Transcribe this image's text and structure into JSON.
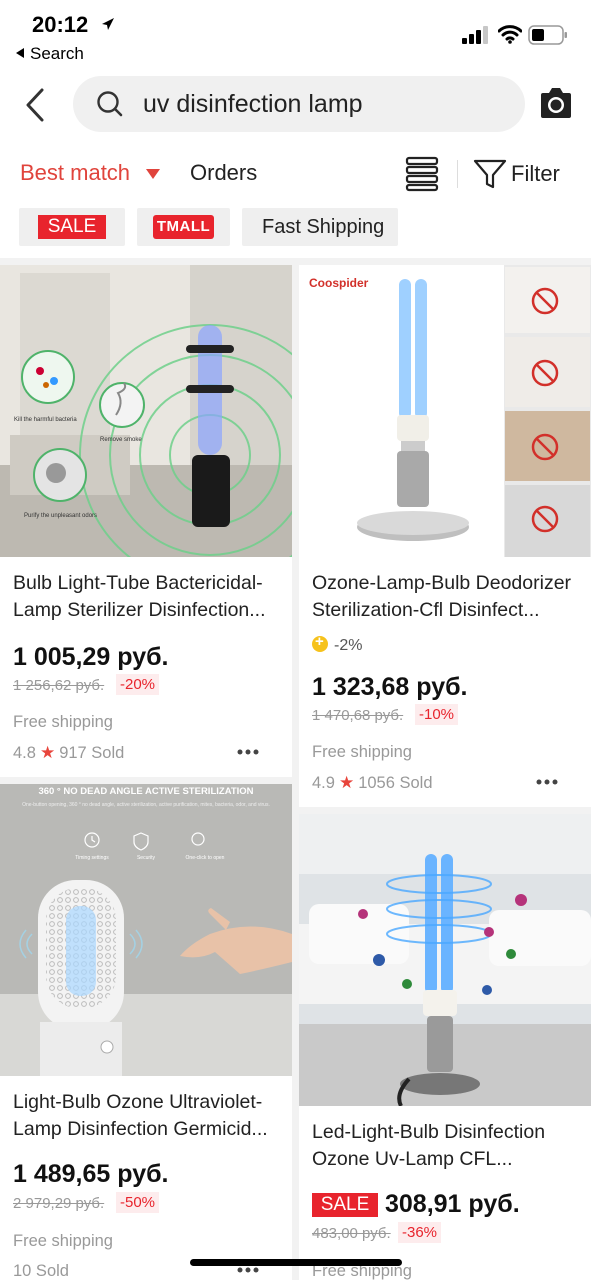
{
  "status": {
    "time": "20:12",
    "back_app": "Search"
  },
  "search": {
    "query": "uv disinfection lamp"
  },
  "sort": {
    "best_match": "Best match",
    "orders": "Orders",
    "filter": "Filter"
  },
  "chips": {
    "sale": "SALE",
    "tmall": "TMALL",
    "fast_shipping": "Fast Shipping"
  },
  "products": [
    {
      "title_line1": "Bulb Light-Tube Bactericidal-",
      "title_line2": "Lamp Sterilizer Disinfection...",
      "price": "1 005,29 руб.",
      "old_price": "1 256,62 руб.",
      "discount": "-20%",
      "shipping": "Free shipping",
      "rating": "4.8",
      "sold": "917 Sold",
      "image_texts": {
        "a": "Kill the harmful bacteria",
        "b": "Remove smoke",
        "c": "Purify the unpleasant odors"
      }
    },
    {
      "title_line1": "Ozone-Lamp-Bulb Deodorizer",
      "title_line2": "Sterilization-Cfl Disinfect...",
      "coin_discount": "-2%",
      "price": "1 323,68 руб.",
      "old_price": "1 470,68 руб.",
      "discount": "-10%",
      "shipping": "Free shipping",
      "rating": "4.9",
      "sold": "1056 Sold",
      "image_texts": {
        "brand": "Coospider"
      }
    },
    {
      "title_line1": "Light-Bulb Ozone Ultraviolet-",
      "title_line2": "Lamp Disinfection Germicid...",
      "price": "1 489,65 руб.",
      "old_price": "2 979,29 руб.",
      "discount": "-50%",
      "shipping": "Free shipping",
      "sold": "10 Sold",
      "image_texts": {
        "headline": "360 ° NO DEAD ANGLE ACTIVE STERILIZATION",
        "sub": "One-button opening, 360 ° no dead angle, active sterilization, active purification, mites, bacteria, odor, and virus.",
        "f1": "Timing settings",
        "f2": "Security",
        "f3": "One-click to open"
      }
    },
    {
      "title_line1": "Led-Light-Bulb Disinfection",
      "title_line2": "Ozone Uv-Lamp CFL...",
      "sale_badge": "SALE",
      "price": "308,91 руб.",
      "old_price": "483,00 руб.",
      "discount": "-36%",
      "shipping": "Free shipping"
    }
  ],
  "colors": {
    "accent": "#e0443c",
    "sale_red": "#e8242d",
    "coin": "#f6c21c"
  }
}
